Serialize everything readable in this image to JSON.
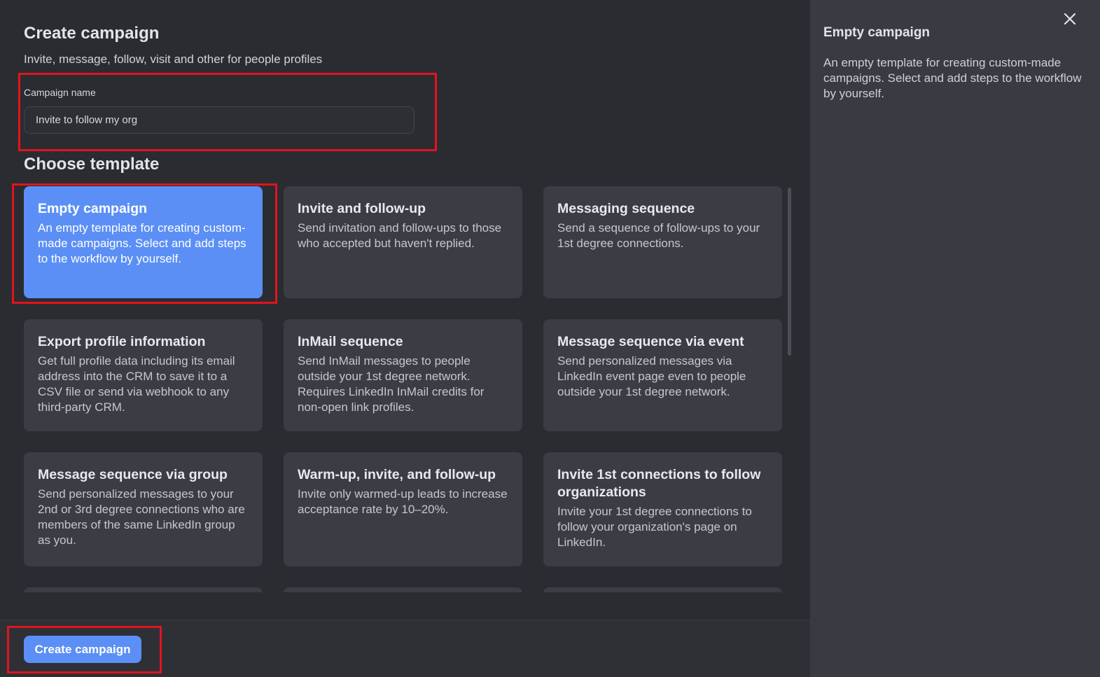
{
  "dialog": {
    "title": "Create campaign",
    "subtitle": "Invite, message, follow, visit and other for people profiles"
  },
  "campaign_name": {
    "label": "Campaign name",
    "value": "Invite to follow my org"
  },
  "templates_section": {
    "title": "Choose template",
    "selected_index": 0,
    "cards": [
      {
        "title": "Empty campaign",
        "description": "An empty template for creating custom-made campaigns. Select and add steps to the workflow by yourself."
      },
      {
        "title": "Invite and follow-up",
        "description": "Send invitation and follow-ups to those who accepted but haven't replied."
      },
      {
        "title": "Messaging sequence",
        "description": "Send a sequence of follow-ups to your 1st degree connections."
      },
      {
        "title": "Export profile information",
        "description": "Get full profile data including its email address into the CRM to save it to a CSV file or send via webhook to any third-party CRM."
      },
      {
        "title": "InMail sequence",
        "description": "Send InMail messages to people outside your 1st degree network. Requires LinkedIn InMail credits for non-open link profiles."
      },
      {
        "title": "Message sequence via event",
        "description": "Send personalized messages via LinkedIn event page even to people outside your 1st degree network."
      },
      {
        "title": "Message sequence via group",
        "description": "Send personalized messages to your 2nd or 3rd degree connections who are members of the same LinkedIn group as you."
      },
      {
        "title": "Warm-up, invite, and follow-up",
        "description": "Invite only warmed-up leads to increase acceptance rate by 10–20%."
      },
      {
        "title": "Invite 1st connections to follow organizations",
        "description": "Invite your 1st degree connections to follow your organization's page on LinkedIn."
      }
    ]
  },
  "footer": {
    "create_label": "Create campaign"
  },
  "side_panel": {
    "title": "Empty campaign",
    "description": "An empty template for creating custom-made campaigns. Select and add steps to the workflow by yourself.",
    "close_icon": "close-icon"
  },
  "colors": {
    "accent": "#5b8ff5",
    "highlight": "#e0141e",
    "background": "#2b2c31",
    "card": "#3c3d44"
  }
}
